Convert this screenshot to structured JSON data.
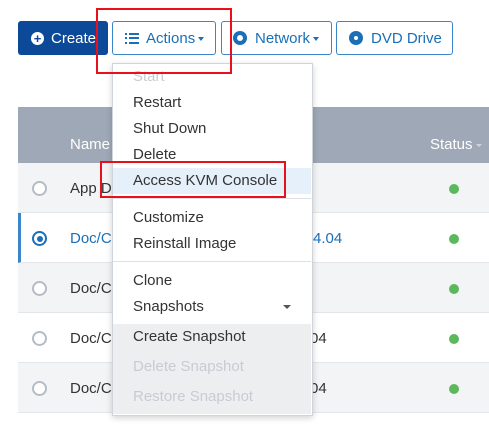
{
  "toolbar": {
    "create_label": "Create",
    "actions_label": "Actions",
    "network_label": "Network",
    "dvd_label": "DVD Drive"
  },
  "table": {
    "headers": {
      "name": "Name",
      "status": "Status"
    },
    "rows": [
      {
        "name": "App De",
        "dist": "",
        "selected": false,
        "status_color": "#5cb85c"
      },
      {
        "name": "Doc/Co",
        "dist": "4.04",
        "selected": true,
        "status_color": "#5cb85c"
      },
      {
        "name": "Doc/Co",
        "dist": "",
        "selected": false,
        "status_color": "#5cb85c"
      },
      {
        "name": "Doc/Co",
        "dist": "04",
        "selected": false,
        "status_color": "#5cb85c"
      },
      {
        "name": "Doc/Co",
        "dist": "04",
        "selected": false,
        "status_color": "#5cb85c"
      }
    ]
  },
  "actions_menu": {
    "start": "Start",
    "restart": "Restart",
    "shutdown": "Shut Down",
    "delete": "Delete",
    "kvm": "Access KVM Console",
    "customize": "Customize",
    "reinstall": "Reinstall Image",
    "clone": "Clone",
    "snapshots": "Snapshots",
    "create_snapshot": "Create Snapshot",
    "delete_snapshot": "Delete Snapshot",
    "restore_snapshot": "Restore Snapshot"
  },
  "colors": {
    "primary": "#0c4a99",
    "accent": "#1a6fb7",
    "status_running": "#5cb85c",
    "highlight_box": "#e8101b"
  }
}
